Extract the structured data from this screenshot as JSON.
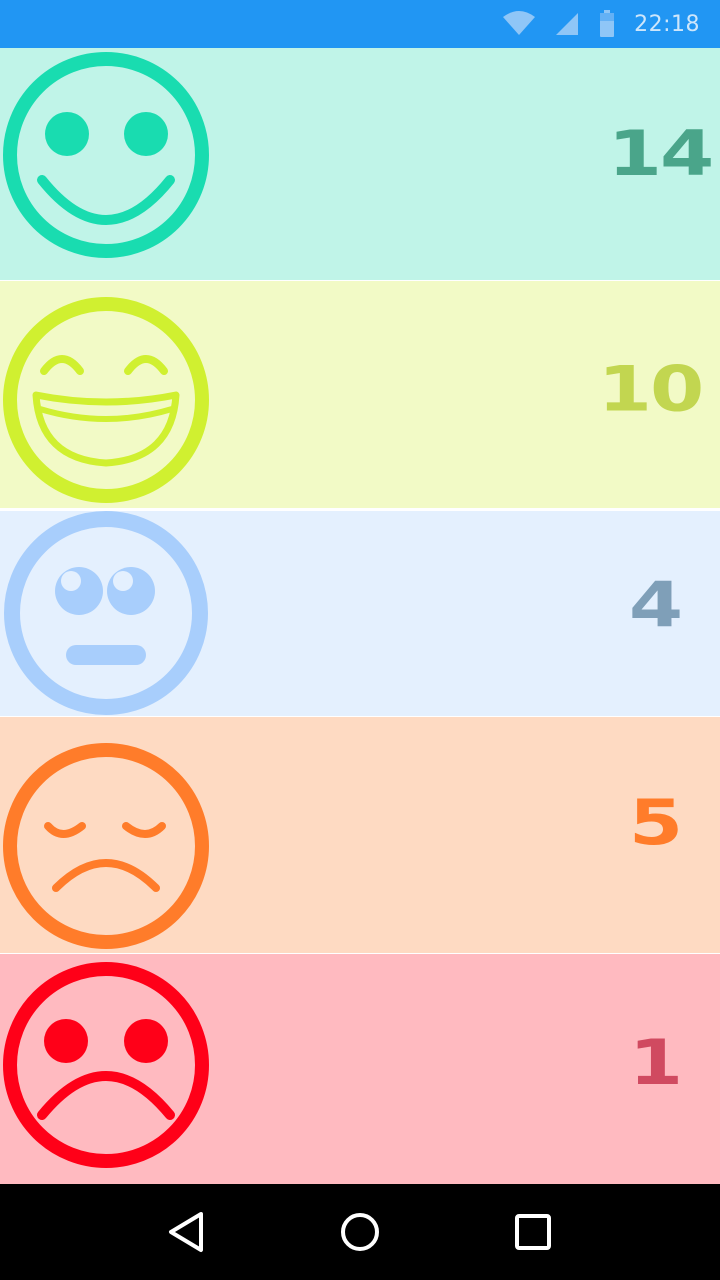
{
  "status_bar": {
    "time": "22:18",
    "icons": [
      "wifi-icon",
      "cellular-signal-icon",
      "battery-icon"
    ]
  },
  "mood_rows": [
    {
      "mood": "very-happy",
      "icon": "smiling-face-icon",
      "count": "14",
      "face_color": "#19dcb0",
      "bg_color": "#c0f4e8",
      "count_color": "#4aa58a"
    },
    {
      "mood": "happy",
      "icon": "grinning-face-icon",
      "count": "10",
      "face_color": "#d0f030",
      "bg_color": "#f2fac6",
      "count_color": "#c2d650"
    },
    {
      "mood": "neutral",
      "icon": "eye-roll-face-icon",
      "count": "4",
      "face_color": "#a8cefc",
      "bg_color": "#e4f0fe",
      "count_color": "#7f9fb8"
    },
    {
      "mood": "sad",
      "icon": "sad-face-icon",
      "count": "5",
      "face_color": "#ff7c2a",
      "bg_color": "#fedac2",
      "count_color": "#ff7c2a"
    },
    {
      "mood": "very-sad",
      "icon": "frowning-face-icon",
      "count": "1",
      "face_color": "#ff0018",
      "bg_color": "#ffbac0",
      "count_color": "#d04a60"
    }
  ],
  "nav_bar": {
    "buttons": [
      "back-button",
      "home-button",
      "recents-button"
    ]
  }
}
